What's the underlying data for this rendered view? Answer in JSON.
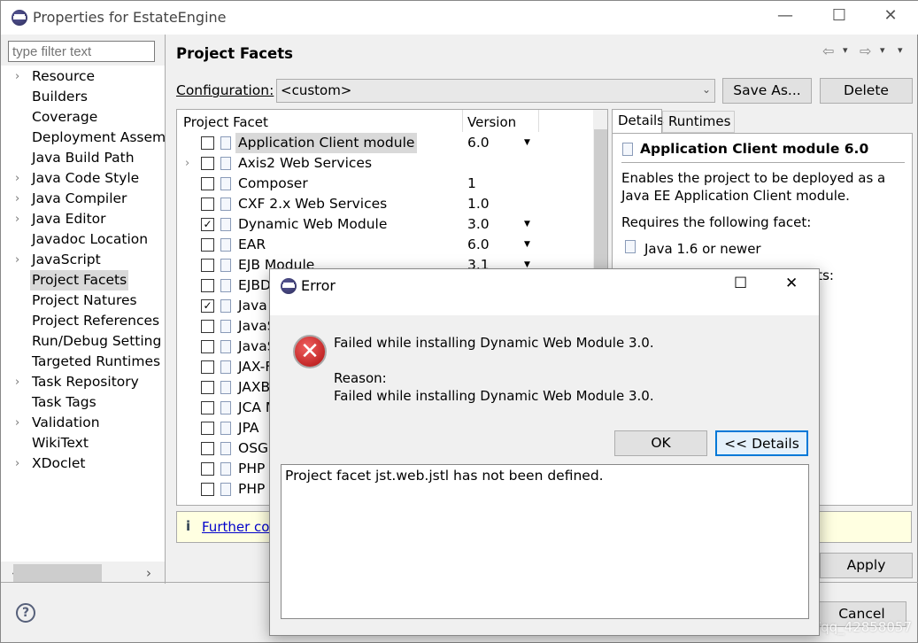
{
  "window": {
    "title": "Properties for EstateEngine",
    "minimize": "—",
    "maximize": "☐",
    "close": "✕"
  },
  "sidebar": {
    "filter_placeholder": "type filter text",
    "items": [
      {
        "label": "Resource",
        "expandable": true
      },
      {
        "label": "Builders"
      },
      {
        "label": "Coverage"
      },
      {
        "label": "Deployment Assem"
      },
      {
        "label": "Java Build Path"
      },
      {
        "label": "Java Code Style",
        "expandable": true
      },
      {
        "label": "Java Compiler",
        "expandable": true
      },
      {
        "label": "Java Editor",
        "expandable": true
      },
      {
        "label": "Javadoc Location"
      },
      {
        "label": "JavaScript",
        "expandable": true
      },
      {
        "label": "Project Facets",
        "selected": true
      },
      {
        "label": "Project Natures"
      },
      {
        "label": "Project References"
      },
      {
        "label": "Run/Debug Setting"
      },
      {
        "label": "Targeted Runtimes"
      },
      {
        "label": "Task Repository",
        "expandable": true
      },
      {
        "label": "Task Tags"
      },
      {
        "label": "Validation",
        "expandable": true
      },
      {
        "label": "WikiText"
      },
      {
        "label": "XDoclet",
        "expandable": true
      }
    ]
  },
  "main": {
    "title": "Project Facets",
    "nav_back": "⇦",
    "nav_fwd": "⇨",
    "menu": "▾",
    "configuration": {
      "label": "Configuration:",
      "value": "<custom>",
      "save_as": "Save As...",
      "delete": "Delete"
    },
    "table": {
      "headers": [
        "Project Facet",
        "Version"
      ],
      "rows": [
        {
          "name": "Application Client module",
          "version": "6.0",
          "dropdown": true,
          "checked": false,
          "selected": true
        },
        {
          "name": "Axis2 Web Services",
          "version": "",
          "checked": false,
          "expandable": true
        },
        {
          "name": "Composer",
          "version": "1",
          "checked": false
        },
        {
          "name": "CXF 2.x Web Services",
          "version": "1.0",
          "checked": false
        },
        {
          "name": "Dynamic Web Module",
          "version": "3.0",
          "dropdown": true,
          "checked": true
        },
        {
          "name": "EAR",
          "version": "6.0",
          "dropdown": true,
          "checked": false
        },
        {
          "name": "EJB Module",
          "version": "3.1",
          "dropdown": true,
          "checked": false
        },
        {
          "name": "EJBDo",
          "version": "",
          "checked": false
        },
        {
          "name": "Java",
          "version": "",
          "checked": true
        },
        {
          "name": "JavaS",
          "version": "",
          "checked": false
        },
        {
          "name": "JavaS",
          "version": "",
          "checked": false
        },
        {
          "name": "JAX-F",
          "version": "",
          "checked": false
        },
        {
          "name": "JAXB",
          "version": "",
          "checked": false
        },
        {
          "name": "JCA M",
          "version": "",
          "checked": false
        },
        {
          "name": "JPA",
          "version": "",
          "checked": false
        },
        {
          "name": "OSGi",
          "version": "",
          "checked": false
        },
        {
          "name": "PHP (",
          "version": "",
          "checked": false
        },
        {
          "name": "PHP I",
          "version": "",
          "checked": false
        }
      ]
    },
    "details": {
      "tabs": [
        "Details",
        "Runtimes"
      ],
      "heading": "Application Client module 6.0",
      "description_1": "Enables the project to be deployed as a",
      "description_2": "Java EE Application Client module.",
      "requires": "Requires the following facet:",
      "required_facet": "Java 1.6 or newer",
      "partial": "ets:"
    },
    "info": {
      "icon": "i",
      "link": "Further co"
    },
    "apply": "Apply"
  },
  "footer": {
    "help": "?",
    "cancel": "Cancel"
  },
  "dialog": {
    "title": "Error",
    "message": "Failed while installing Dynamic Web Module 3.0.",
    "reason_label": "Reason:",
    "reason": "Failed while installing Dynamic Web Module 3.0.",
    "ok": "OK",
    "details": "<< Details",
    "details_text": "Project facet jst.web.jstl has not been defined.",
    "maximize": "☐",
    "close": "✕"
  },
  "watermark": "https://blog.csdn.net/qq_42858057"
}
